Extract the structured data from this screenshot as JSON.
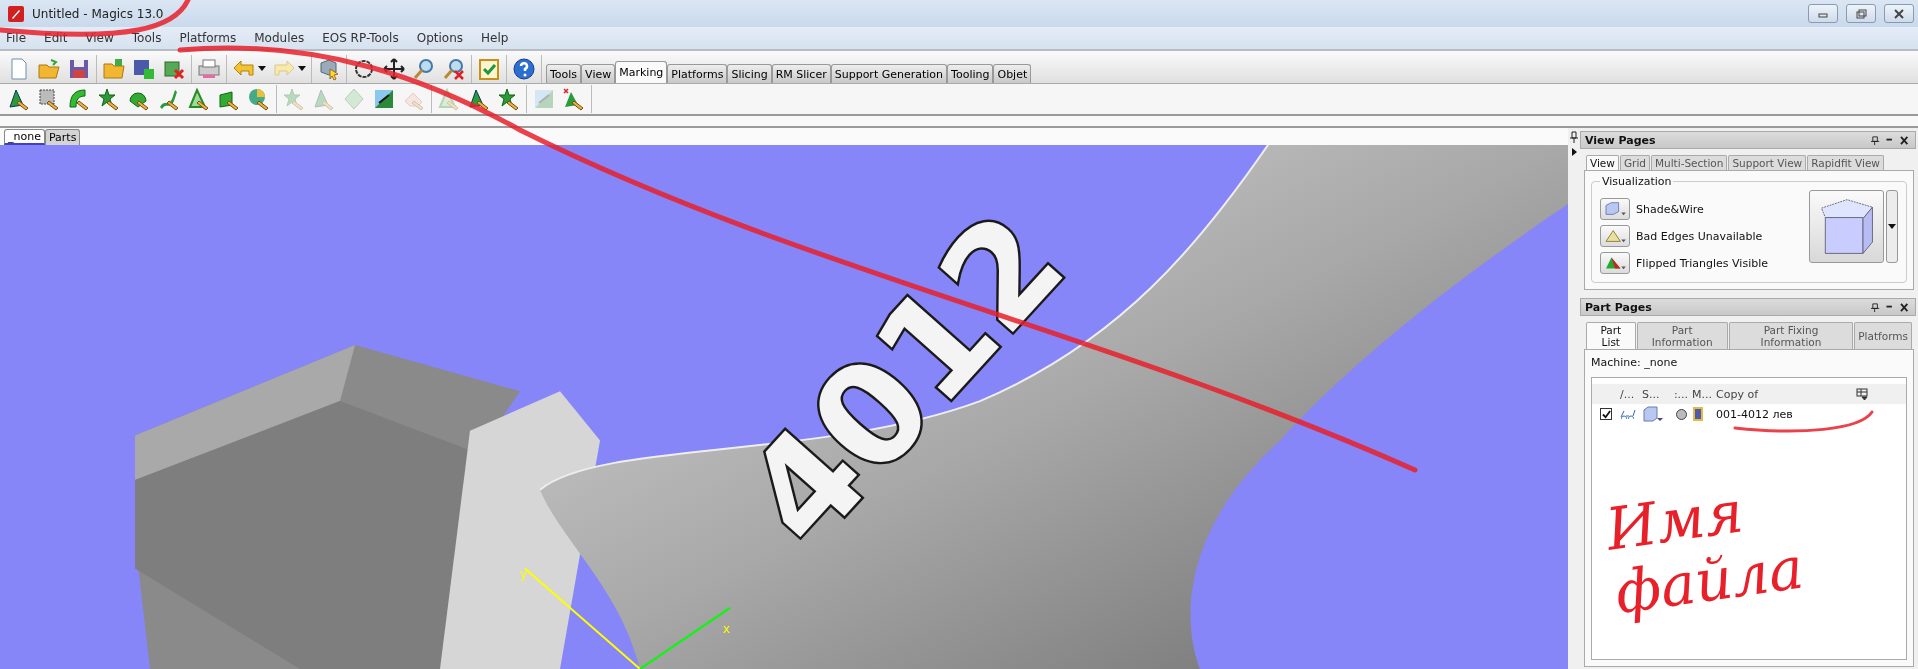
{
  "window": {
    "title": "Untitled - Magics 13.0"
  },
  "menu": [
    "File",
    "Edit",
    "View",
    "Tools",
    "Platforms",
    "Modules",
    "EOS RP-Tools",
    "Options",
    "Help"
  ],
  "toolbar_main": [
    [
      {
        "kind": "new"
      },
      {
        "kind": "open"
      },
      {
        "kind": "save"
      }
    ],
    [
      {
        "kind": "open-folder"
      },
      {
        "kind": "save-part"
      },
      {
        "kind": "delete-part"
      }
    ],
    [
      {
        "kind": "print"
      }
    ],
    [
      {
        "kind": "undo"
      },
      {
        "kind": "redo"
      }
    ],
    [
      {
        "kind": "select"
      }
    ],
    [
      {
        "kind": "rotate"
      },
      {
        "kind": "move"
      },
      {
        "kind": "zoom"
      },
      {
        "kind": "zoom-clear"
      }
    ],
    [
      {
        "kind": "check"
      }
    ],
    [
      {
        "kind": "help"
      }
    ]
  ],
  "ribbon_tabs": [
    {
      "label": "Tools",
      "selected": false
    },
    {
      "label": "View",
      "selected": false
    },
    {
      "label": "Marking",
      "selected": true
    },
    {
      "label": "Platforms",
      "selected": false
    },
    {
      "label": "Slicing",
      "selected": false
    },
    {
      "label": "RM Slicer",
      "selected": false
    },
    {
      "label": "Support Generation",
      "selected": false
    },
    {
      "label": "Tooling",
      "selected": false
    },
    {
      "label": "Objet",
      "selected": false
    }
  ],
  "toolbar_marking": [
    [
      {
        "kind": "triangle",
        "disabled": false
      },
      {
        "kind": "grid",
        "disabled": false
      },
      {
        "kind": "arc",
        "disabled": false
      },
      {
        "kind": "star",
        "disabled": false
      },
      {
        "kind": "shell",
        "disabled": false
      },
      {
        "kind": "curve",
        "disabled": false
      },
      {
        "kind": "outline",
        "disabled": false
      },
      {
        "kind": "square",
        "disabled": false
      },
      {
        "kind": "sphere",
        "disabled": false
      }
    ],
    [
      {
        "kind": "star",
        "disabled": true
      },
      {
        "kind": "triangle",
        "disabled": true
      },
      {
        "kind": "diamond",
        "disabled": true
      },
      {
        "kind": "swap",
        "disabled": false
      },
      {
        "kind": "eraser",
        "disabled": true
      }
    ],
    [
      {
        "kind": "outline",
        "disabled": true
      },
      {
        "kind": "triangle",
        "disabled": false
      },
      {
        "kind": "star",
        "disabled": false
      }
    ],
    [
      {
        "kind": "swap",
        "disabled": true
      },
      {
        "kind": "remove",
        "disabled": false
      }
    ]
  ],
  "document_tabs": [
    {
      "label": "_none",
      "selected": true
    },
    {
      "label": "Parts",
      "selected": false
    }
  ],
  "viewport": {
    "model_label": "4012",
    "axes": [
      "y",
      "x"
    ]
  },
  "view_pages": {
    "title": "View Pages",
    "tabs": [
      {
        "label": "View",
        "selected": true
      },
      {
        "label": "Grid",
        "selected": false
      },
      {
        "label": "Multi-Section",
        "selected": false
      },
      {
        "label": "Support View",
        "selected": false
      },
      {
        "label": "Rapidfit View",
        "selected": false
      }
    ],
    "group": "Visualization",
    "options": [
      {
        "kind": "shade",
        "label": "Shade&Wire"
      },
      {
        "kind": "edges",
        "label": "Bad Edges Unavailable"
      },
      {
        "kind": "flipped",
        "label": "Flipped Triangles Visible"
      }
    ]
  },
  "part_pages": {
    "title": "Part Pages",
    "tabs": [
      {
        "label": "Part List",
        "selected": true
      },
      {
        "label": "Part Information",
        "selected": false
      },
      {
        "label": "Part Fixing Information",
        "selected": false
      },
      {
        "label": "Platforms",
        "selected": false
      }
    ],
    "machine": "Machine: _none",
    "columns": [
      "/...",
      "S...",
      ":...",
      "M...",
      "Copy of"
    ],
    "rows": [
      {
        "checked": true,
        "name": "001-4012 лев"
      }
    ]
  },
  "annotation": {
    "note": "Имя файла"
  }
}
